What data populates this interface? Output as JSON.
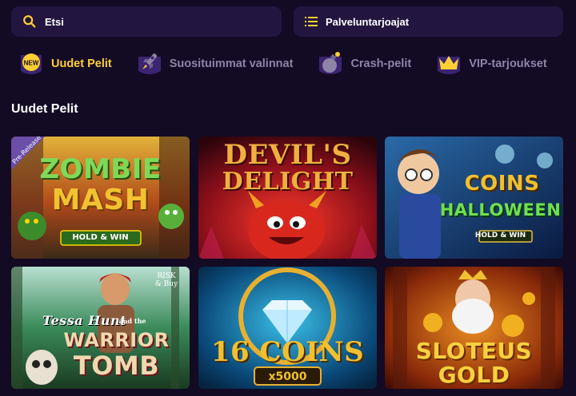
{
  "search": {
    "placeholder": "Etsi"
  },
  "providers": {
    "label": "Palveluntarjoajat"
  },
  "categories": [
    {
      "label": "Uudet Pelit",
      "icon": "new-badge-icon",
      "active": true,
      "badge": "NEW"
    },
    {
      "label": "Suosituimmat valinnat",
      "icon": "rocket-icon",
      "active": false
    },
    {
      "label": "Crash-pelit",
      "icon": "bomb-icon",
      "active": false
    },
    {
      "label": "VIP-tarjoukset",
      "icon": "crown-icon",
      "active": false
    }
  ],
  "section": {
    "title": "Uudet Pelit"
  },
  "games": [
    {
      "title": "ZOMBIE MASH",
      "line1": "ZOMBIE",
      "line2": "MASH",
      "sub": "HOLD & WIN",
      "corner": "Pre-Release"
    },
    {
      "title": "DEVIL'S DELIGHT",
      "line1": "DEVIL'S",
      "line2": "DELIGHT"
    },
    {
      "title": "COINS HALLOWEEN",
      "line1": "COINS",
      "line2": "HALLOWEEN",
      "sub": "HOLD & WIN"
    },
    {
      "title": "Tessa Hunt and the WARRIOR TOMB",
      "line0": "Tessa Hunt",
      "line0b": "and the",
      "line1": "WARRIOR",
      "line2": "TOMB",
      "corner": "RISK & Buy"
    },
    {
      "title": "16 COINS x5000",
      "line1": "16 COINS",
      "sub": "x5000"
    },
    {
      "title": "SLOTEUS GOLD",
      "line1": "SLOTEUS",
      "line2": "GOLD"
    }
  ],
  "colors": {
    "accent": "#ffcf33",
    "panel": "#221640",
    "background": "#130a24",
    "muted": "#8d84a6"
  }
}
